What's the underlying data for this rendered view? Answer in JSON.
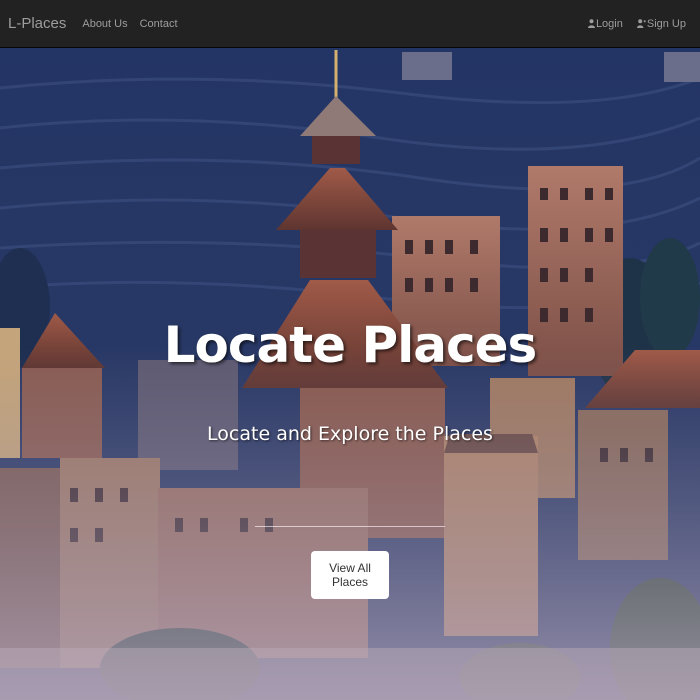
{
  "navbar": {
    "brand": "L-Places",
    "links": {
      "about": "About Us",
      "contact": "Contact"
    },
    "right": {
      "login": "Login",
      "signup": "Sign Up"
    }
  },
  "hero": {
    "title": "Locate Places",
    "subtitle": "Locate and Explore the Places",
    "button_label": "View All Places"
  },
  "icons": {
    "login": "user-icon",
    "signup": "user-plus-icon"
  },
  "colors": {
    "navbar_bg": "#222222",
    "nav_text": "#9d9d9d",
    "hero_text": "#ffffff",
    "button_bg": "#ffffff",
    "button_text": "#333333"
  }
}
